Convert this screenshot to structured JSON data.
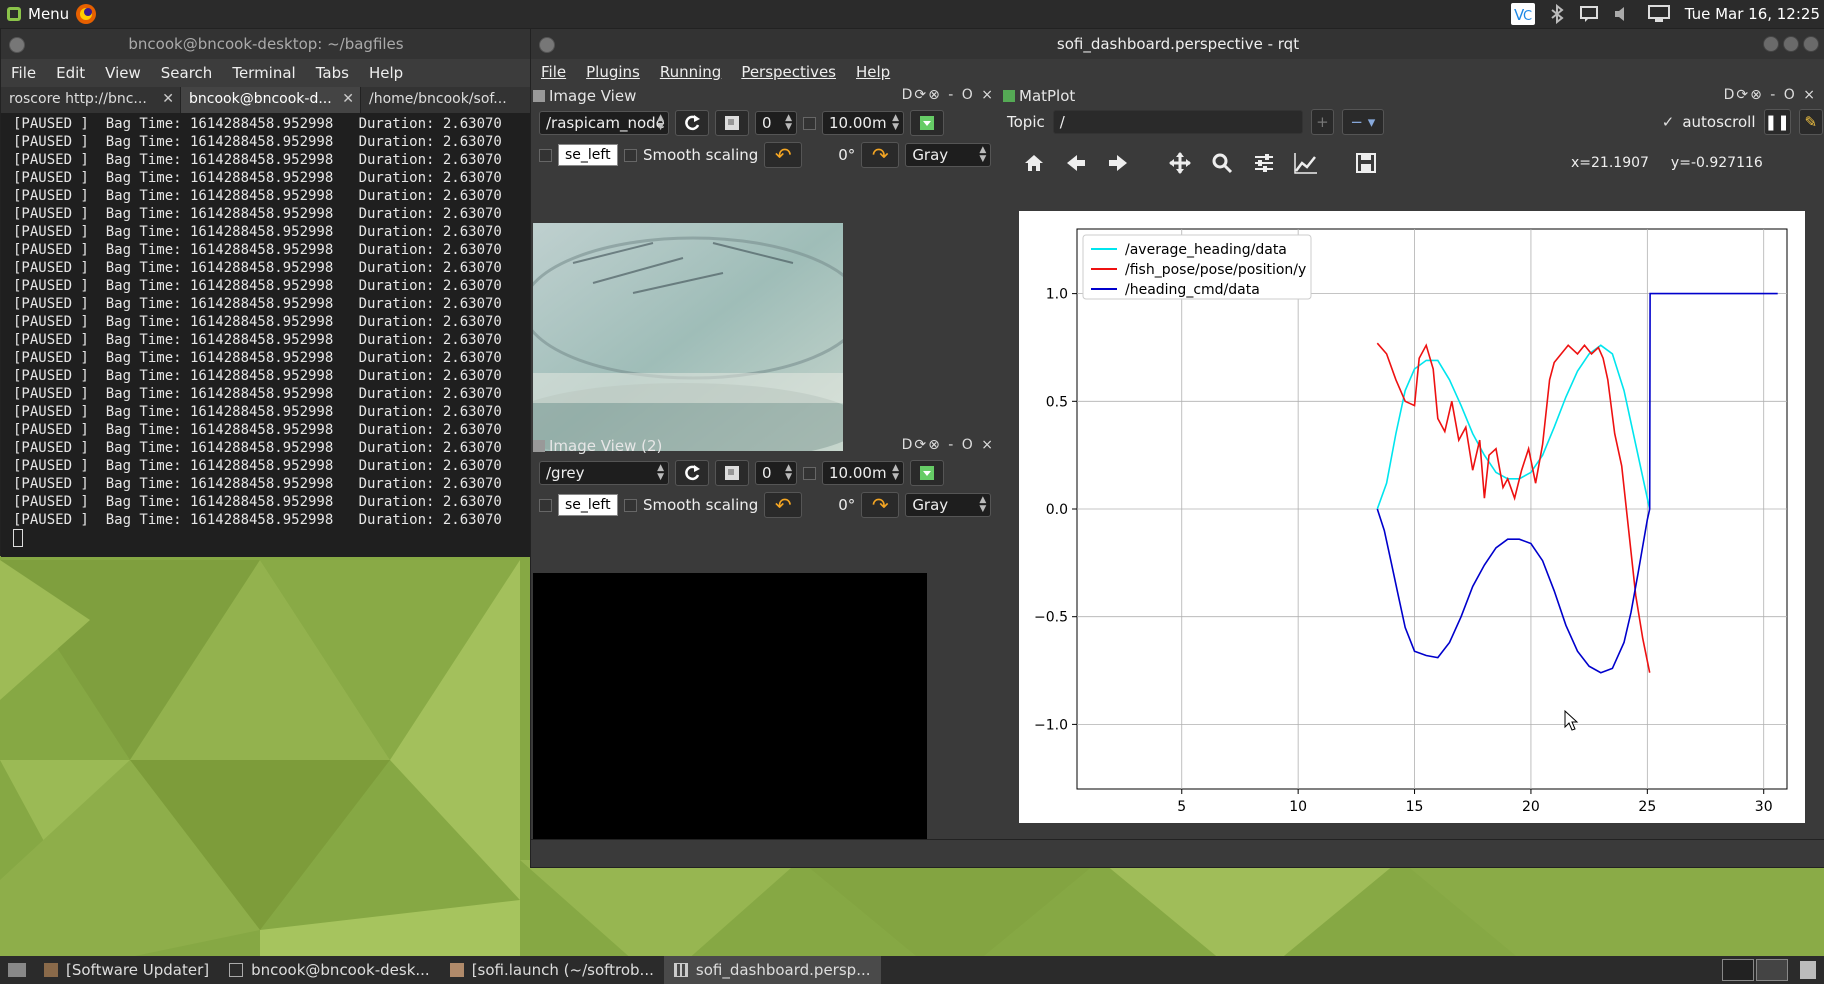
{
  "topbar": {
    "menu_label": "Menu",
    "clock": "Tue Mar 16, 12:25",
    "tray_icons": [
      "vscode-icon",
      "bluetooth-icon",
      "chat-icon",
      "volume-icon",
      "network-icon"
    ]
  },
  "terminal": {
    "title": "bncook@bncook-desktop: ~/bagfiles",
    "menu": [
      "File",
      "Edit",
      "View",
      "Search",
      "Terminal",
      "Tabs",
      "Help"
    ],
    "tabs": [
      {
        "label": "roscore http://bnc..."
      },
      {
        "label": "bncook@bncook-d..."
      },
      {
        "label": "/home/bncook/sof..."
      }
    ],
    "line": "[PAUSED ]  Bag Time: 1614288458.952998   Duration: 2.63070",
    "line_count": 23
  },
  "rqt": {
    "title": "sofi_dashboard.perspective - rqt",
    "menu": [
      "File",
      "Plugins",
      "Running",
      "Perspectives",
      "Help"
    ],
    "image_view_1": {
      "title": "Image View",
      "topic": "/raspicam_node",
      "spin_value": "0",
      "rate": "10.00m",
      "topic2": "se_left",
      "smooth_label": "Smooth scaling",
      "rotation": "0°",
      "color_mode": "Gray"
    },
    "image_view_2": {
      "title": "Image View (2)",
      "topic": "/grey",
      "spin_value": "0",
      "rate": "10.00m",
      "topic2": "se_left",
      "smooth_label": "Smooth scaling",
      "rotation": "0°",
      "color_mode": "Gray"
    },
    "matplot": {
      "title": "MatPlot",
      "topic_label": "Topic",
      "topic_value": "/",
      "autoscroll_label": "autoscroll",
      "coords_x": "x=21.1907",
      "coords_y": "y=-0.927116"
    },
    "pane_ctl": "D⟳⊗ - O ×"
  },
  "chart_data": {
    "type": "line",
    "title": "",
    "xlabel": "",
    "ylabel": "",
    "xlim": [
      0.5,
      31
    ],
    "ylim": [
      -1.3,
      1.3
    ],
    "xticks": [
      5,
      10,
      15,
      20,
      25,
      30
    ],
    "yticks": [
      -1.0,
      -0.5,
      0.0,
      0.5,
      1.0
    ],
    "xtick_labels": [
      "5",
      "10",
      "15",
      "20",
      "25",
      "30"
    ],
    "ytick_labels": [
      "−1.0",
      "−0.5",
      "0.0",
      "0.5",
      "1.0"
    ],
    "grid": true,
    "legend": "top-left",
    "series": [
      {
        "name": "/average_heading/data",
        "color": "#00e5ee",
        "x": [
          13.4,
          13.8,
          14.2,
          14.6,
          15.0,
          15.5,
          16.0,
          16.5,
          17.0,
          17.5,
          18.0,
          18.5,
          19.0,
          19.5,
          20.0,
          20.5,
          21.0,
          21.5,
          22.0,
          22.5,
          23.0,
          23.5,
          24.0,
          24.5,
          25.0,
          25.1
        ],
        "y": [
          0.0,
          0.12,
          0.35,
          0.55,
          0.65,
          0.69,
          0.69,
          0.6,
          0.48,
          0.35,
          0.25,
          0.17,
          0.14,
          0.14,
          0.17,
          0.25,
          0.38,
          0.52,
          0.64,
          0.72,
          0.76,
          0.72,
          0.55,
          0.3,
          0.05,
          0.0
        ]
      },
      {
        "name": "/fish_pose/pose/position/y",
        "color": "#ee1111",
        "x": [
          13.4,
          13.8,
          14.2,
          14.6,
          15.0,
          15.2,
          15.5,
          15.8,
          16.0,
          16.3,
          16.6,
          16.9,
          17.2,
          17.5,
          17.8,
          18.0,
          18.2,
          18.5,
          18.8,
          19.0,
          19.3,
          19.6,
          19.9,
          20.2,
          20.5,
          20.8,
          21.0,
          21.3,
          21.6,
          22.0,
          22.3,
          22.6,
          22.9,
          23.1,
          23.3,
          23.6,
          23.9,
          24.2,
          24.5,
          24.8,
          25.1
        ],
        "y": [
          0.77,
          0.72,
          0.6,
          0.5,
          0.48,
          0.7,
          0.76,
          0.65,
          0.42,
          0.36,
          0.5,
          0.32,
          0.38,
          0.18,
          0.32,
          0.05,
          0.25,
          0.28,
          0.1,
          0.14,
          0.05,
          0.18,
          0.28,
          0.12,
          0.3,
          0.6,
          0.68,
          0.72,
          0.76,
          0.72,
          0.76,
          0.72,
          0.75,
          0.7,
          0.6,
          0.35,
          0.2,
          -0.1,
          -0.4,
          -0.6,
          -0.76
        ]
      },
      {
        "name": "/heading_cmd/data",
        "color": "#0000cc",
        "x": [
          13.4,
          13.7,
          14.0,
          14.3,
          14.6,
          15.0,
          15.5,
          16.0,
          16.5,
          17.0,
          17.5,
          18.0,
          18.5,
          19.0,
          19.5,
          20.0,
          20.5,
          21.0,
          21.5,
          22.0,
          22.5,
          23.0,
          23.5,
          24.0,
          24.3,
          24.6,
          25.0,
          25.1,
          25.12,
          28.0,
          30.6
        ],
        "y": [
          0.0,
          -0.1,
          -0.25,
          -0.4,
          -0.55,
          -0.66,
          -0.68,
          -0.69,
          -0.62,
          -0.5,
          -0.36,
          -0.26,
          -0.18,
          -0.14,
          -0.14,
          -0.16,
          -0.24,
          -0.38,
          -0.54,
          -0.66,
          -0.73,
          -0.76,
          -0.74,
          -0.62,
          -0.48,
          -0.3,
          -0.05,
          0.0,
          1.0,
          1.0,
          1.0
        ]
      }
    ]
  },
  "taskbar": {
    "items": [
      {
        "label": "[Software Updater]",
        "active": false
      },
      {
        "label": "bncook@bncook-desk...",
        "active": false
      },
      {
        "label": "[sofi.launch (~/softrob...",
        "active": false
      },
      {
        "label": "sofi_dashboard.persp...",
        "active": true
      }
    ]
  },
  "colors": {
    "panel": "#3c3c3c",
    "terminal_bg": "#1f1f1f",
    "accent_orange": "#f5a623"
  }
}
